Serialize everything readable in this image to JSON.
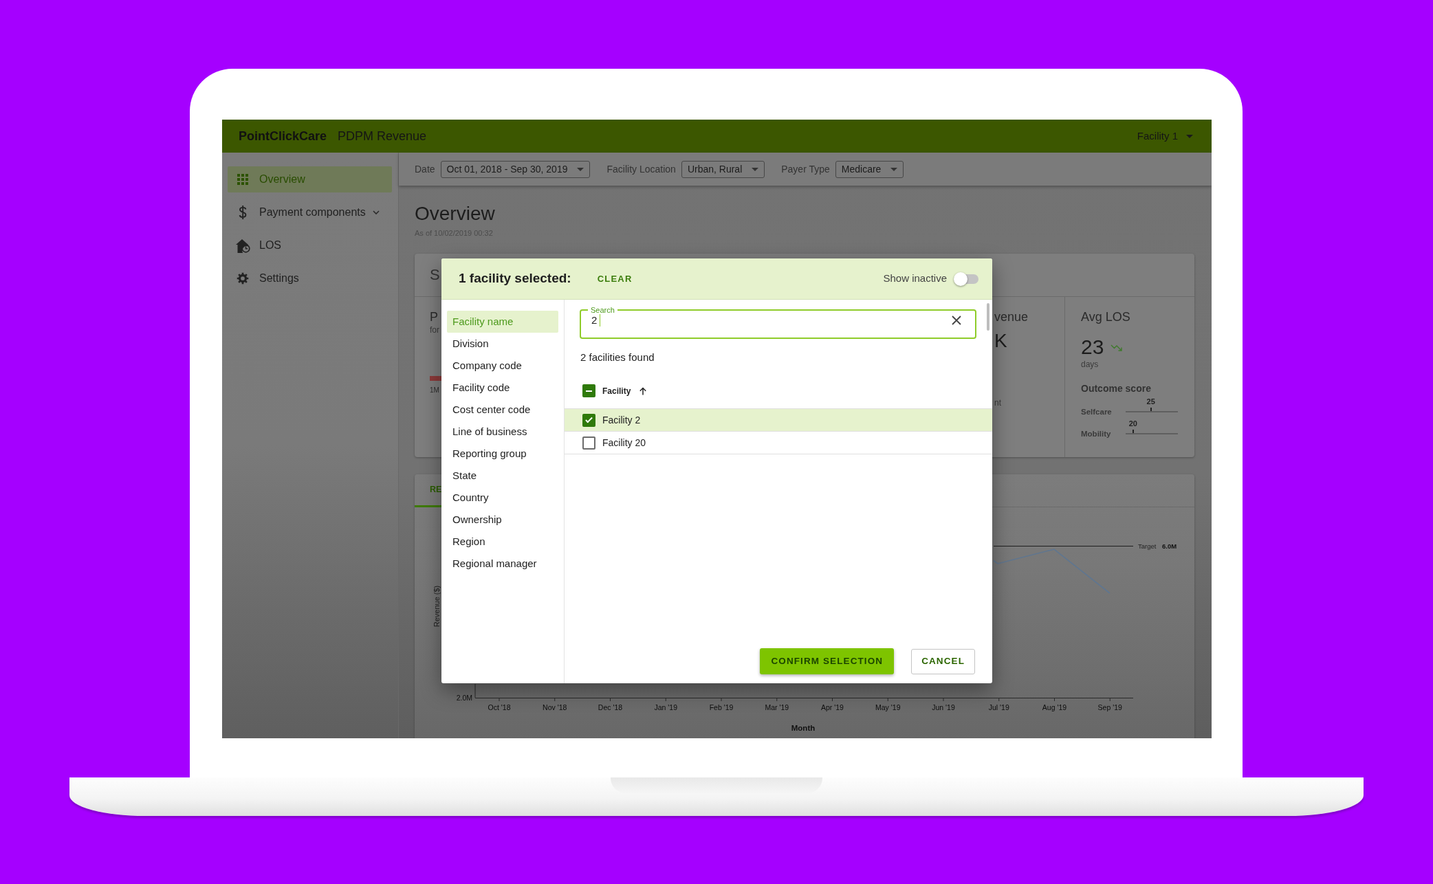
{
  "app_bar": {
    "brand": "PointClickCare",
    "title": "PDPM Revenue",
    "facility_menu": "Facility 1"
  },
  "sidebar": {
    "items": [
      {
        "label": "Overview",
        "selected": true,
        "expandable": false
      },
      {
        "label": "Payment components",
        "selected": false,
        "expandable": true
      },
      {
        "label": "LOS",
        "selected": false,
        "expandable": false
      },
      {
        "label": "Settings",
        "selected": false,
        "expandable": false
      }
    ]
  },
  "filters": [
    {
      "label": "Date",
      "value": "Oct 01, 2018 - Sep 30, 2019"
    },
    {
      "label": "Facility Location",
      "value": "Urban, Rural"
    },
    {
      "label": "Payer Type",
      "value": "Medicare"
    }
  ],
  "page": {
    "title": "Overview",
    "as_of": "As of 10/02/2019 00:32"
  },
  "summary_card": {
    "heading": "S",
    "column_1": {
      "title": "P",
      "subtitle": "for",
      "tick_label": "1M"
    },
    "column_2": {
      "title": "venue",
      "value": "K",
      "caption": "nt"
    },
    "avg_los": {
      "title": "Avg LOS",
      "value": "23",
      "unit": "days",
      "outcome_title": "Outcome score",
      "scores": [
        {
          "label": "Selfcare",
          "reading": "25",
          "level": 0.47
        },
        {
          "label": "Mobility",
          "reading": "20",
          "level": 0.13
        }
      ]
    }
  },
  "revenue_card": {
    "tabs": [
      {
        "label": "RE",
        "selected": true
      }
    ],
    "chart": {
      "y_axis_title": "Revenue ($)",
      "y_tick_label": "2.0M",
      "month_labels": [
        "Oct '18",
        "Nov '18",
        "Dec '18",
        "Jan '19",
        "Feb '19",
        "Mar '19",
        "Apr '19",
        "May '19",
        "Jun '19",
        "Jul '19",
        "Aug '19",
        "Sep '19"
      ],
      "x_axis_title": "Month",
      "target_label": "Target",
      "target_value": "6.0M"
    }
  },
  "dialog": {
    "title": "1 facility selected:",
    "clear_button": "CLEAR",
    "show_inactive": {
      "label": "Show inactive",
      "on": false
    },
    "filter_fields": [
      {
        "label": "Facility name",
        "selected": true
      },
      {
        "label": "Division",
        "selected": false
      },
      {
        "label": "Company code",
        "selected": false
      },
      {
        "label": "Facility code",
        "selected": false
      },
      {
        "label": "Cost center code",
        "selected": false
      },
      {
        "label": "Line of business",
        "selected": false
      },
      {
        "label": "Reporting group",
        "selected": false
      },
      {
        "label": "State",
        "selected": false
      },
      {
        "label": "Country",
        "selected": false
      },
      {
        "label": "Ownership",
        "selected": false
      },
      {
        "label": "Region",
        "selected": false
      },
      {
        "label": "Regional manager",
        "selected": false
      }
    ],
    "search": {
      "label": "Search",
      "value": "2"
    },
    "result_count": "2 facilities found",
    "table": {
      "column": "Facility",
      "sort_ascending": true,
      "select_all_indeterminate": true,
      "rows": [
        {
          "name": "Facility 2",
          "checked": true
        },
        {
          "name": "Facility 20",
          "checked": false
        }
      ]
    },
    "buttons": [
      {
        "label": "CONFIRM SELECTION",
        "kind": "primary"
      },
      {
        "label": "CANCEL",
        "kind": "outline"
      }
    ]
  }
}
